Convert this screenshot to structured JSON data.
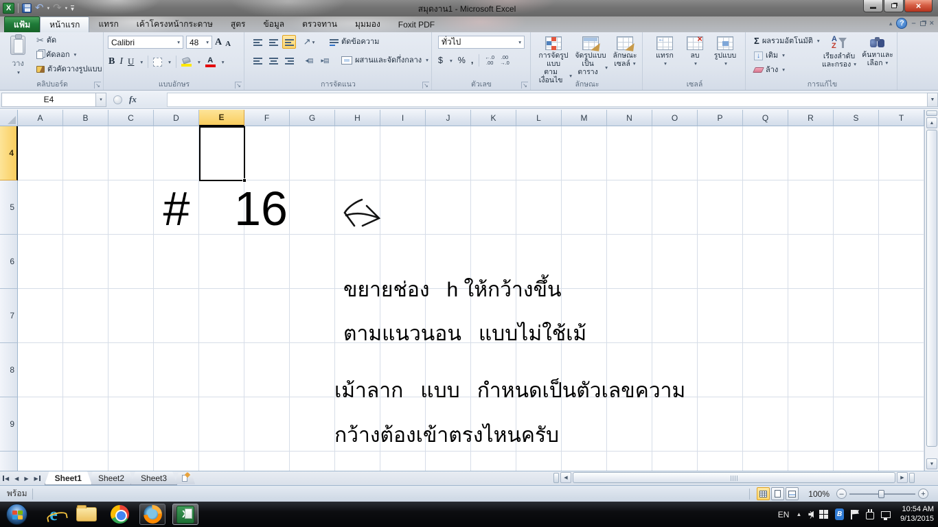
{
  "window": {
    "title": "สมุดงาน1 - Microsoft Excel"
  },
  "tabs": {
    "file": "แฟ้ม",
    "home": "หน้าแรก",
    "insert": "แทรก",
    "page_layout": "เค้าโครงหน้ากระดาษ",
    "formulas": "สูตร",
    "data": "ข้อมูล",
    "review": "ตรวจทาน",
    "view": "มุมมอง",
    "foxit": "Foxit PDF"
  },
  "ribbon": {
    "clipboard": {
      "label": "คลิปบอร์ด",
      "paste": "วาง",
      "cut": "ตัด",
      "copy": "คัดลอก",
      "format_painter": "ตัวคัดวางรูปแบบ"
    },
    "font": {
      "label": "แบบอักษร",
      "family": "Calibri",
      "size": "48"
    },
    "alignment": {
      "label": "การจัดแนว",
      "wrap_text": "ตัดข้อความ",
      "merge_center": "ผสานและจัดกึ่งกลาง"
    },
    "number": {
      "label": "ตัวเลข",
      "format": "ทั่วไป"
    },
    "styles": {
      "label": "ลักษณะ",
      "conditional_1": "การจัดรูปแบบ",
      "conditional_2": "ตามเงื่อนไข",
      "table_1": "จัดรูปแบบ",
      "table_2": "เป็นตาราง",
      "cell_styles_1": "ลักษณะ",
      "cell_styles_2": "เซลล์"
    },
    "cells": {
      "label": "เซลล์",
      "insert": "แทรก",
      "delete": "ลบ",
      "format": "รูปแบบ"
    },
    "editing": {
      "label": "การแก้ไข",
      "autosum": "ผลรวมอัตโนมัติ",
      "fill": "เติม",
      "clear": "ล้าง",
      "sort_1": "เรียงลำดับ",
      "sort_2": "และกรอง",
      "find_1": "ค้นหาและ",
      "find_2": "เลือก"
    }
  },
  "formula_bar": {
    "cell_ref": "E4",
    "fx": "fx"
  },
  "grid": {
    "columns": [
      "A",
      "B",
      "C",
      "D",
      "E",
      "F",
      "G",
      "H",
      "I",
      "J",
      "K",
      "L",
      "M",
      "N",
      "O",
      "P",
      "Q",
      "R",
      "S",
      "T"
    ],
    "rows": [
      "4",
      "5",
      "6",
      "7",
      "8",
      "9"
    ],
    "selected_cell": "E4",
    "cells": {
      "d5": "#",
      "f5": "16"
    },
    "annotations": [
      "ขยายช่อง   h ให้กว้างขึ้น",
      "ตามแนวนอน   แบบไม่ใช้เม้",
      "เม้าลาก   แบบ   กำหนดเป็นตัวเลขความ",
      "กว้างต้องเข้าตรงไหนครับ"
    ]
  },
  "sheets": {
    "tab1": "Sheet1",
    "tab2": "Sheet2",
    "tab3": "Sheet3"
  },
  "status": {
    "mode": "พร้อม",
    "zoom": "100%"
  },
  "taskbar": {
    "language": "EN",
    "time": "10:54 AM",
    "date": "9/13/2015"
  },
  "icons": {
    "undo": "↶",
    "redo": "↷",
    "dropdown": "▾",
    "cut": "✂",
    "bold": "B",
    "italic": "I",
    "underline": "U",
    "grow_font": "A",
    "shrink_font": "A",
    "font_color": "A",
    "orientation": "↗",
    "indent_left": "◂▤",
    "indent_right": "▸▤",
    "sigma": "Σ",
    "dollar": "$",
    "percent": "%",
    "comma": ",",
    "inc_dec_top": "←.0",
    "inc_dec_bottom": ".00",
    "dec_dec_top": ".00",
    "dec_dec_bottom": "→.0",
    "fill_arrow": "↓",
    "help": "?",
    "close": "×",
    "chevron_up": "▴",
    "tri_left": "◀",
    "tri_right": "▶",
    "tri_up": "▲",
    "tri_down": "▼",
    "zoom_out": "–",
    "zoom_in": "+",
    "launcher": "↘"
  },
  "colors": {
    "file_tab_green": "#2f8f46",
    "selection_header": "#f9cd5e",
    "font_color_red": "#e40000",
    "fill_color_yellow": "#ffe800"
  }
}
